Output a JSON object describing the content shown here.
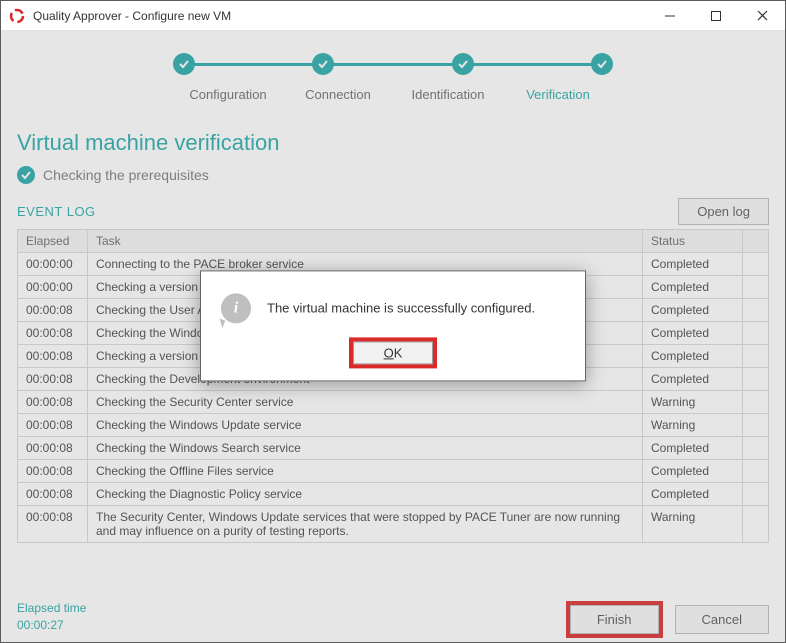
{
  "window": {
    "title": "Quality Approver - Configure new VM"
  },
  "stepper": {
    "steps": [
      "Configuration",
      "Connection",
      "Identification",
      "Verification"
    ],
    "active_index": 3
  },
  "section": {
    "title": "Virtual machine verification"
  },
  "prereq": {
    "label": "Checking the prerequisites"
  },
  "eventlog": {
    "title": "EVENT LOG",
    "open_label": "Open log",
    "columns": {
      "elapsed": "Elapsed",
      "task": "Task",
      "status": "Status"
    },
    "rows": [
      {
        "elapsed": "00:00:00",
        "task": "Connecting to the PACE broker service",
        "status": "Completed"
      },
      {
        "elapsed": "00:00:00",
        "task": "Checking a version of the PACE Listener",
        "status": "Completed"
      },
      {
        "elapsed": "00:00:08",
        "task": "Checking the User Account Control",
        "status": "Completed"
      },
      {
        "elapsed": "00:00:08",
        "task": "Checking the Windows Firewall feature",
        "status": "Completed"
      },
      {
        "elapsed": "00:00:08",
        "task": "Checking a version of the PACE Tuner",
        "status": "Completed"
      },
      {
        "elapsed": "00:00:08",
        "task": "Checking the Development environment",
        "status": "Completed"
      },
      {
        "elapsed": "00:00:08",
        "task": "Checking the Security Center service",
        "status": "Warning"
      },
      {
        "elapsed": "00:00:08",
        "task": "Checking the Windows Update service",
        "status": "Warning"
      },
      {
        "elapsed": "00:00:08",
        "task": "Checking the Windows Search service",
        "status": "Completed"
      },
      {
        "elapsed": "00:00:08",
        "task": "Checking the Offline Files service",
        "status": "Completed"
      },
      {
        "elapsed": "00:00:08",
        "task": "Checking the Diagnostic Policy service",
        "status": "Completed"
      },
      {
        "elapsed": "00:00:08",
        "task": "The Security Center, Windows Update services that were stopped by PACE Tuner are now running and may influence on a purity of testing reports.",
        "status": "Warning"
      }
    ]
  },
  "footer": {
    "elapsed_label": "Elapsed time",
    "elapsed_value": "00:00:27",
    "finish_label": "Finish",
    "cancel_label": "Cancel"
  },
  "modal": {
    "message": "The virtual machine is successfully configured.",
    "ok_label": "OK"
  },
  "colors": {
    "accent": "#24A6A0",
    "highlight": "#DA2A2A"
  }
}
